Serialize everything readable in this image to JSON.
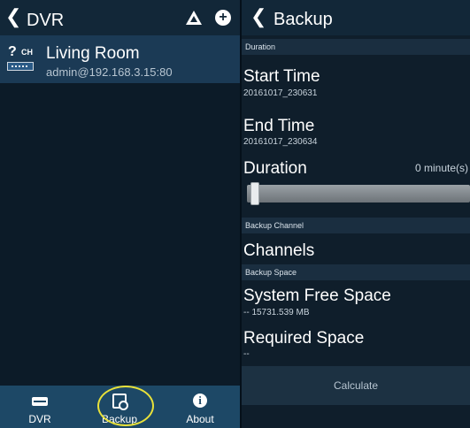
{
  "left": {
    "title": "DVR",
    "device": {
      "status": "?",
      "badge": "CH",
      "name": "Living Room",
      "address": "admin@192.168.3.15:80"
    },
    "nav": [
      {
        "label": "DVR",
        "icon": "dvr-icon"
      },
      {
        "label": "Backup",
        "icon": "backup-icon"
      },
      {
        "label": "About",
        "icon": "info-icon"
      }
    ]
  },
  "right": {
    "title": "Backup",
    "duration_section": "Duration",
    "start_time_label": "Start Time",
    "start_time_value": "20161017_230631",
    "end_time_label": "End Time",
    "end_time_value": "20161017_230634",
    "duration_label": "Duration",
    "duration_value": "0 minute(s)",
    "slider_value": 0,
    "backup_channel_section": "Backup Channel",
    "channels_label": "Channels",
    "backup_space_section": "Backup Space",
    "system_free_label": "System Free Space",
    "system_free_value": "-- 15731.539 MB",
    "required_label": "Required Space",
    "required_value": "--",
    "calculate_label": "Calculate"
  },
  "colors": {
    "accent_ring": "#e8e13a",
    "selected_row": "#1b3a55",
    "nav_bg": "#1d4866"
  }
}
